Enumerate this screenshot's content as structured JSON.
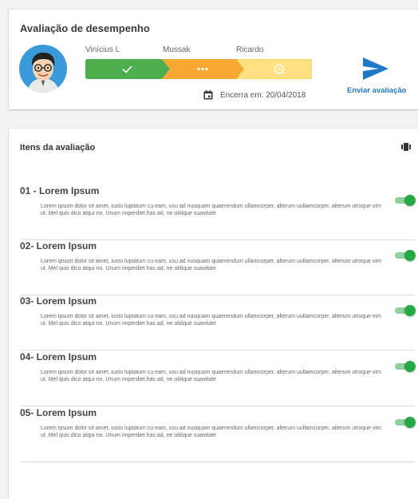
{
  "header": {
    "title": "Avaliação de desempenho",
    "steps": [
      {
        "name": "Vinícius L",
        "status": "complete",
        "icon": "check-icon"
      },
      {
        "name": "Mussak",
        "status": "in-progress",
        "icon": "dots-icon"
      },
      {
        "name": "Ricardo",
        "status": "pending",
        "icon": "clock-icon"
      }
    ],
    "deadline": "Encerra em: 20/04/2018",
    "send_label": "Enviar avaliação"
  },
  "items_section": {
    "title": "Itens da avaliação",
    "items": [
      {
        "title": "01 - Lorem Ipsum",
        "description": "Lorem ipsum dolor sit amet, iusto luptatum cu eam, usu ad nusquam quaerendum ullamcorper, alterum uullamcorper, alterum utroque vim ut. Mel quis dico atqui no. Unum imperdiet has ad, ne oblique suavitate",
        "enabled": true
      },
      {
        "title": "02- Lorem Ipsum",
        "description": "Lorem ipsum dolor sit amet, iusto luptatum cu eam, usu ad nusquam quaerendum ullamcorper, alterum uullamcorper, alterum utroque vim ut. Mel quis dico atqui no. Unum imperdiet has ad, ne oblique suavitate",
        "enabled": true
      },
      {
        "title": "03- Lorem Ipsum",
        "description": "Lorem ipsum dolor sit amet, iusto luptatum cu eam, usu ad nusquam quaerendum ullamcorper, alterum uullamcorper, alterum utroque vim ut. Mel quis dico atqui no. Unum imperdiet has ad, ne oblique suavitate",
        "enabled": true
      },
      {
        "title": "04- Lorem Ipsum",
        "description": "Lorem ipsum dolor sit amet, iusto luptatum cu eam, usu ad nusquam quaerendum ullamcorper, alterum uullamcorper, alterum utroque vim ut. Mel quis dico atqui no. Unum imperdiet has ad, ne oblique suavitate",
        "enabled": true
      },
      {
        "title": "05- Lorem Ipsum",
        "description": "Lorem ipsum dolor sit amet, iusto luptatum cu eam, usu ad nusquam quaerendum ullamcorper, alterum uullamcorper, alterum utroque vim ut. Mel quis dico atqui no. Unum imperdiet has ad, ne oblique suavitate",
        "enabled": true
      }
    ]
  },
  "colors": {
    "step_complete": "#4cae4c",
    "step_in_progress": "#f7a833",
    "step_pending": "#ffe083",
    "accent_blue": "#1f78c8",
    "toggle_on": "#28a745"
  }
}
